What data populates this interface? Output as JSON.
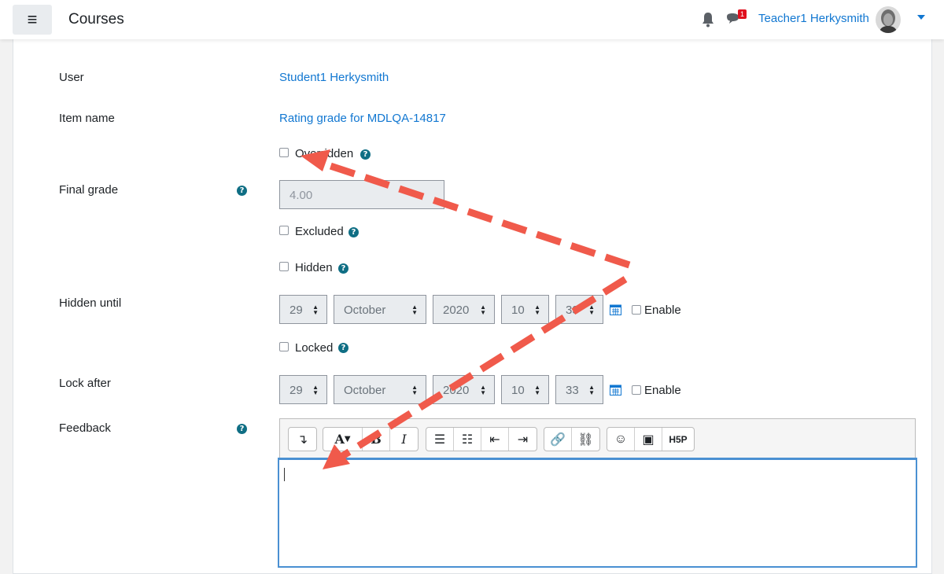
{
  "navbar": {
    "menu_icon": "hamburger-icon",
    "title": "Courses",
    "notification_icon": "bell-icon",
    "message_icon": "chat-icon",
    "message_badge": "1",
    "user_name": "Teacher1 Herkysmith",
    "avatar_icon": "user-avatar",
    "accent_color": "#1177d1"
  },
  "form": {
    "user_label": "User",
    "user_value": "Student1 Herkysmith",
    "item_label": "Item name",
    "item_value": "Rating grade for MDLQA-14817",
    "overridden_label": "Overridden",
    "final_grade_label": "Final grade",
    "final_grade_value": "4.00",
    "excluded_label": "Excluded",
    "hidden_label": "Hidden",
    "hidden_until_label": "Hidden until",
    "hidden_until": {
      "day": "29",
      "month": "October",
      "year": "2020",
      "hour": "10",
      "minute": "33",
      "enable_label": "Enable"
    },
    "locked_label": "Locked",
    "lock_after_label": "Lock after",
    "lock_after": {
      "day": "29",
      "month": "October",
      "year": "2020",
      "hour": "10",
      "minute": "33",
      "enable_label": "Enable"
    },
    "feedback_label": "Feedback",
    "help_glyph": "?"
  },
  "editor": {
    "tools": [
      "show-more-icon",
      "font-color-icon",
      "bold-icon",
      "italic-icon",
      "unordered-list-icon",
      "ordered-list-icon",
      "outdent-icon",
      "indent-icon",
      "link-icon",
      "unlink-icon",
      "emoticon-icon",
      "image-icon",
      "h5p-icon"
    ],
    "h5p_label": "H5P",
    "bold_label": "B",
    "italic_label": "I",
    "font_label": "A"
  },
  "annotation": {
    "arrow_color": "#f05a4b"
  }
}
